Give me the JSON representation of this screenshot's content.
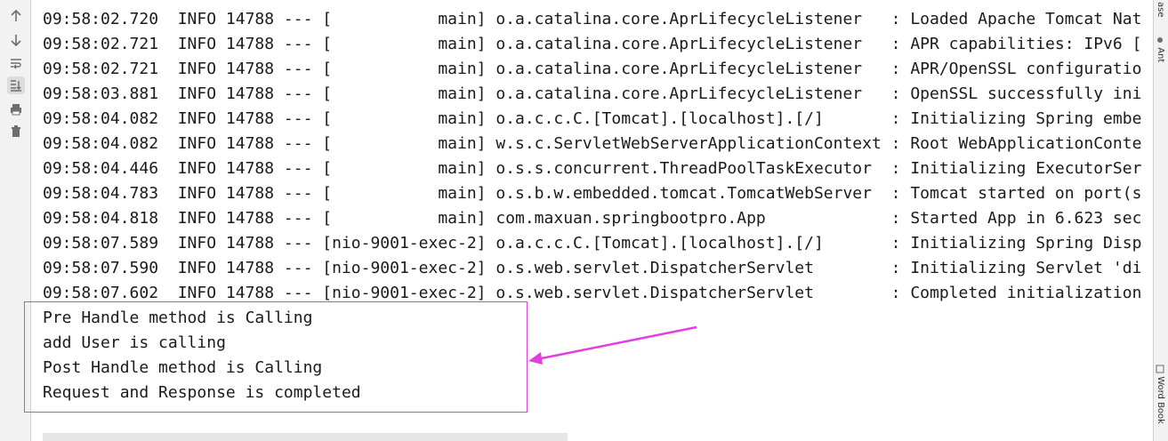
{
  "toolbar": {
    "icons": [
      "up-arrow-icon",
      "down-arrow-icon",
      "soft-wrap-icon",
      "scroll-to-end-icon",
      "print-icon",
      "trash-icon"
    ]
  },
  "right_strip": {
    "top_label": "ase",
    "mid_label": "Ant",
    "bottom_label": "Word Book"
  },
  "log_lines": [
    "09:58:02.720  INFO 14788 --- [           main] o.a.catalina.core.AprLifecycleListener   : Loaded Apache Tomcat Nat",
    "09:58:02.721  INFO 14788 --- [           main] o.a.catalina.core.AprLifecycleListener   : APR capabilities: IPv6 [",
    "09:58:02.721  INFO 14788 --- [           main] o.a.catalina.core.AprLifecycleListener   : APR/OpenSSL configuratio",
    "09:58:03.881  INFO 14788 --- [           main] o.a.catalina.core.AprLifecycleListener   : OpenSSL successfully ini",
    "09:58:04.082  INFO 14788 --- [           main] o.a.c.c.C.[Tomcat].[localhost].[/]       : Initializing Spring embe",
    "09:58:04.082  INFO 14788 --- [           main] w.s.c.ServletWebServerApplicationContext : Root WebApplicationConte",
    "09:58:04.446  INFO 14788 --- [           main] o.s.s.concurrent.ThreadPoolTaskExecutor  : Initializing ExecutorSer",
    "09:58:04.783  INFO 14788 --- [           main] o.s.b.w.embedded.tomcat.TomcatWebServer  : Tomcat started on port(s",
    "09:58:04.818  INFO 14788 --- [           main] com.maxuan.springbootpro.App             : Started App in 6.623 sec",
    "09:58:07.589  INFO 14788 --- [nio-9001-exec-2] o.a.c.c.C.[Tomcat].[localhost].[/]       : Initializing Spring Disp",
    "09:58:07.590  INFO 14788 --- [nio-9001-exec-2] o.s.web.servlet.DispatcherServlet        : Initializing Servlet 'di",
    "09:58:07.602  INFO 14788 --- [nio-9001-exec-2] o.s.web.servlet.DispatcherServlet        : Completed initialization",
    "Pre Handle method is Calling",
    "add User is calling",
    "Post Handle method is Calling",
    "Request and Response is completed"
  ],
  "colors": {
    "highlight": "#e23ee2"
  }
}
